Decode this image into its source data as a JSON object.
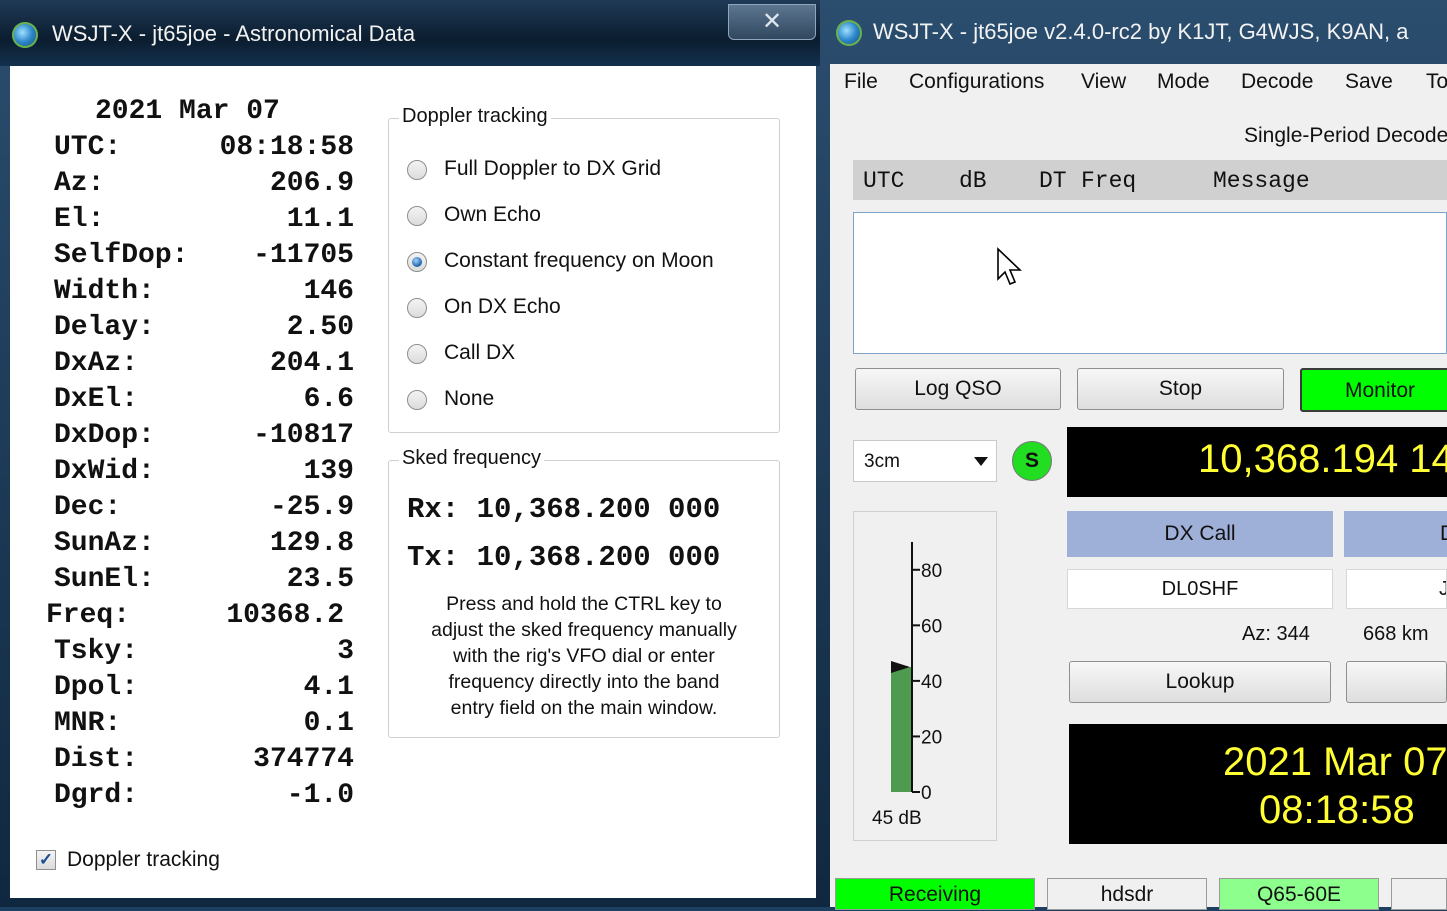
{
  "astro_window": {
    "title": "WSJT-X - jt65joe - Astronomical Data",
    "close_glyph": "✕",
    "date": "2021 Mar 07",
    "rows": [
      {
        "label": "UTC:",
        "value": "08:18:58"
      },
      {
        "label": "Az:",
        "value": "206.9"
      },
      {
        "label": "El:",
        "value": "11.1"
      },
      {
        "label": "SelfDop:",
        "value": "-11705"
      },
      {
        "label": "Width:",
        "value": "146"
      },
      {
        "label": "Delay:",
        "value": "2.50"
      },
      {
        "label": "DxAz:",
        "value": "204.1"
      },
      {
        "label": "DxEl:",
        "value": "6.6"
      },
      {
        "label": "DxDop:",
        "value": "-10817"
      },
      {
        "label": "DxWid:",
        "value": "139"
      },
      {
        "label": "Dec:",
        "value": "-25.9"
      },
      {
        "label": "SunAz:",
        "value": "129.8"
      },
      {
        "label": "SunEl:",
        "value": "23.5"
      },
      {
        "label": "Freq:",
        "value": "10368.2"
      },
      {
        "label": "Tsky:",
        "value": "3"
      },
      {
        "label": "Dpol:",
        "value": "4.1"
      },
      {
        "label": "MNR:",
        "value": "0.1"
      },
      {
        "label": "Dist:",
        "value": "374774"
      },
      {
        "label": "Dgrd:",
        "value": "-1.0"
      }
    ],
    "doppler_group": {
      "title": "Doppler tracking",
      "options": [
        {
          "label": "Full Doppler to DX Grid",
          "checked": false
        },
        {
          "label": "Own Echo",
          "checked": false
        },
        {
          "label": "Constant frequency on Moon",
          "checked": true
        },
        {
          "label": "On DX Echo",
          "checked": false
        },
        {
          "label": "Call DX",
          "checked": false
        },
        {
          "label": "None",
          "checked": false
        }
      ]
    },
    "sked_group": {
      "title": "Sked frequency",
      "rx": "Rx: 10,368.200 000",
      "tx": "Tx: 10,368.200 000",
      "note_lines": [
        "Press and hold the CTRL key to",
        "adjust the sked frequency manually",
        "with the rig's VFO dial or enter",
        "frequency directly into the band",
        "entry field on the main window."
      ]
    },
    "doppler_checkbox": {
      "label": "Doppler tracking",
      "checked": true
    }
  },
  "main_window": {
    "title": "WSJT-X - jt65joe   v2.4.0-rc2   by K1JT, G4WJS, K9AN, a",
    "menu": [
      "File",
      "Configurations",
      "View",
      "Mode",
      "Decode",
      "Save",
      "To"
    ],
    "decode_panel_title": "Single-Period Decode",
    "decode_header": [
      "UTC",
      "dB",
      "DT",
      "Freq",
      "Message"
    ],
    "buttons": {
      "log_qso": "Log QSO",
      "stop": "Stop",
      "monitor": "Monitor",
      "lookup": "Lookup"
    },
    "band": "3cm",
    "s_badge": "S",
    "freq_display": "10,368.194 14",
    "dx_call_label": "DX Call",
    "dx_grid_label_partial": "D",
    "dx_call_value": "DL0SHF",
    "dx_grid_value_partial": "J",
    "azimuth": "Az: 344",
    "distance": "668 km",
    "meter": {
      "ticks": [
        "80",
        "60",
        "40",
        "20",
        "0"
      ],
      "level_db": 45,
      "readout": "45 dB"
    },
    "clock_date": "2021 Mar 07",
    "clock_time": "08:18:58",
    "status": [
      "Receiving",
      "hdsdr",
      "Q65-60E",
      ""
    ],
    "colors": {
      "monitor_on": "#00ff00",
      "receiving": "#00ff00",
      "mode_cell": "#8cff8c",
      "freq_text": "#ffff33",
      "dx_call_bg": "#9fb0d8"
    }
  }
}
